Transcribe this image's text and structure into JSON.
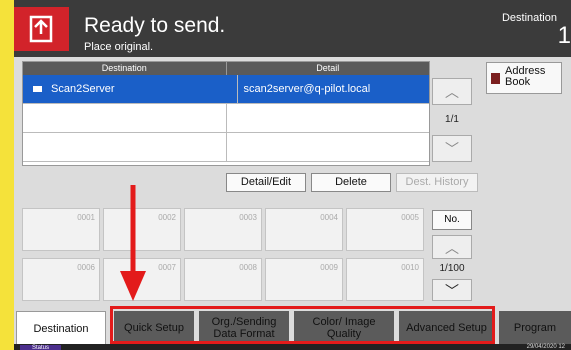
{
  "header": {
    "title": "Ready to send.",
    "subtitle": "Place original.",
    "destination_label": "Destination",
    "destination_count": "1"
  },
  "list": {
    "col_destination": "Destination",
    "col_detail": "Detail",
    "rows": [
      {
        "name": "Scan2Server",
        "detail": "scan2server@q-pilot.local"
      },
      {
        "name": "",
        "detail": ""
      },
      {
        "name": "",
        "detail": ""
      }
    ],
    "page": "1/1"
  },
  "address_book": "Address Book",
  "buttons": {
    "detail_edit": "Detail/Edit",
    "delete": "Delete",
    "dest_history": "Dest. History"
  },
  "one_touch_keys": [
    "0001",
    "0002",
    "0003",
    "0004",
    "0005",
    "0006",
    "0007",
    "0008",
    "0009",
    "0010"
  ],
  "no_button": "No.",
  "key_page": "1/100",
  "tabs": {
    "destination": "Destination",
    "quick_setup": "Quick Setup",
    "org_sending": "Org./Sending Data Format",
    "color_quality": "Color/ Image Quality",
    "advanced": "Advanced Setup",
    "program": "Program"
  },
  "status_bar": {
    "status": "Status",
    "datetime": "29/04/2020  12"
  },
  "colors": {
    "accent_red": "#d2232a",
    "selection_blue": "#1a5fc8",
    "highlight_red": "#e31b1b"
  }
}
